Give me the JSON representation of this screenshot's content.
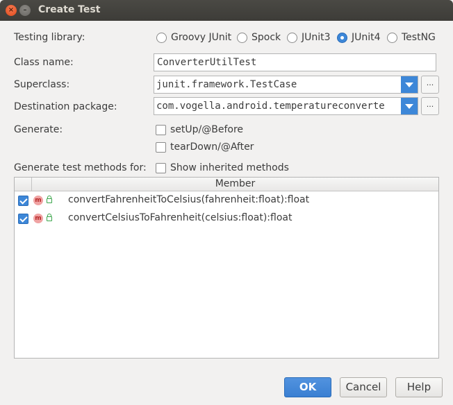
{
  "window": {
    "title": "Create Test"
  },
  "form": {
    "testing_library_label": "Testing library:",
    "libraries": [
      "Groovy JUnit",
      "Spock",
      "JUnit3",
      "JUnit4",
      "TestNG"
    ],
    "selected_library": "JUnit4",
    "class_name_label": "Class name:",
    "class_name_value": "ConverterUtilTest",
    "superclass_label": "Superclass:",
    "superclass_value": "junit.framework.TestCase",
    "destination_label": "Destination package:",
    "destination_value": "com.vogella.android.temperatureconverte",
    "generate_label": "Generate:",
    "setup_label": "setUp/@Before",
    "teardown_label": "tearDown/@After",
    "methods_for_label": "Generate test methods for:",
    "show_inherited_label": "Show inherited methods",
    "browse_label": "..."
  },
  "table": {
    "header": "Member",
    "rows": [
      {
        "name": "convertFahrenheitToCelsius(fahrenheit:float):float",
        "checked": true
      },
      {
        "name": "convertCelsiusToFahrenheit(celsius:float):float",
        "checked": true
      }
    ],
    "method_icon_glyph": "m"
  },
  "buttons": {
    "ok": "OK",
    "cancel": "Cancel",
    "help": "Help"
  },
  "colors": {
    "accent": "#3d87d8",
    "titlebar": "#3d3c38",
    "close": "#e0491b"
  }
}
